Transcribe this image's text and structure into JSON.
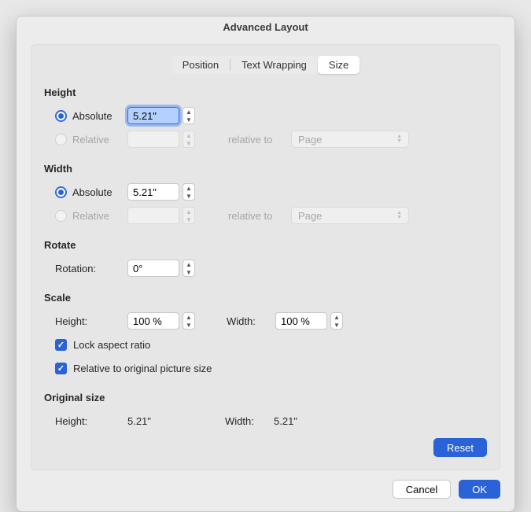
{
  "title": "Advanced Layout",
  "tabs": {
    "position": "Position",
    "textWrapping": "Text Wrapping",
    "size": "Size"
  },
  "height": {
    "title": "Height",
    "absolute": {
      "label": "Absolute",
      "value": "5.21\""
    },
    "relative": {
      "label": "Relative",
      "value": "",
      "relativeToLabel": "relative to",
      "relativeTo": "Page"
    }
  },
  "width": {
    "title": "Width",
    "absolute": {
      "label": "Absolute",
      "value": "5.21\""
    },
    "relative": {
      "label": "Relative",
      "value": "",
      "relativeToLabel": "relative to",
      "relativeTo": "Page"
    }
  },
  "rotate": {
    "title": "Rotate",
    "label": "Rotation:",
    "value": "0°"
  },
  "scale": {
    "title": "Scale",
    "heightLabel": "Height:",
    "heightValue": "100 %",
    "widthLabel": "Width:",
    "widthValue": "100 %",
    "lock": "Lock aspect ratio",
    "relativeOriginal": "Relative to original picture size"
  },
  "original": {
    "title": "Original size",
    "heightLabel": "Height:",
    "heightValue": "5.21\"",
    "widthLabel": "Width:",
    "widthValue": "5.21\""
  },
  "buttons": {
    "reset": "Reset",
    "cancel": "Cancel",
    "ok": "OK"
  }
}
